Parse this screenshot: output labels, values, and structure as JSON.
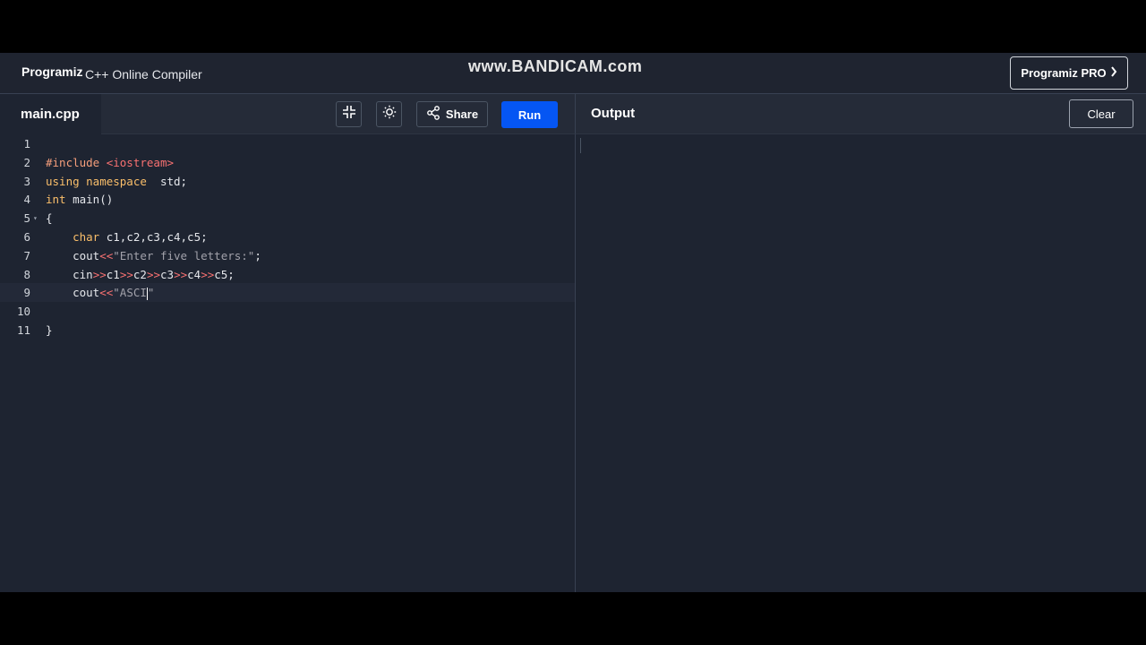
{
  "header": {
    "logo_text": "Programiz",
    "app_title": "C++ Online Compiler",
    "watermark": "www.BANDICAM.com",
    "pro_button": "Programiz PRO"
  },
  "editor_toolbar": {
    "file_name": "main.cpp",
    "share_label": "Share",
    "run_label": "Run"
  },
  "output_panel": {
    "title": "Output",
    "clear_label": "Clear",
    "content": ""
  },
  "code_lines": [
    {
      "n": "1",
      "parts": []
    },
    {
      "n": "2",
      "parts": [
        [
          "kw-pre",
          "#include "
        ],
        [
          "str-inc",
          "<iostream>"
        ]
      ]
    },
    {
      "n": "3",
      "parts": [
        [
          "kw",
          "using namespace"
        ],
        [
          "",
          "  std;"
        ]
      ]
    },
    {
      "n": "4",
      "parts": [
        [
          "ty",
          "int"
        ],
        [
          "",
          " main()"
        ]
      ]
    },
    {
      "n": "5",
      "parts": [
        [
          "",
          "{"
        ]
      ]
    },
    {
      "n": "6",
      "parts": [
        [
          "",
          "    "
        ],
        [
          "ty",
          "char"
        ],
        [
          "",
          " c1,c2,c3,c4,c5;"
        ]
      ]
    },
    {
      "n": "7",
      "parts": [
        [
          "",
          "    cout"
        ],
        [
          "op",
          "<<"
        ],
        [
          "str",
          "\"Enter five letters:\""
        ],
        [
          "",
          ";"
        ]
      ]
    },
    {
      "n": "8",
      "parts": [
        [
          "",
          "    cin"
        ],
        [
          "op",
          ">>"
        ],
        [
          "",
          "c1"
        ],
        [
          "op",
          ">>"
        ],
        [
          "",
          "c2"
        ],
        [
          "op",
          ">>"
        ],
        [
          "",
          "c3"
        ],
        [
          "op",
          ">>"
        ],
        [
          "",
          "c4"
        ],
        [
          "op",
          ">>"
        ],
        [
          "",
          "c5;"
        ]
      ]
    },
    {
      "n": "9",
      "parts": [
        [
          "",
          "    cout"
        ],
        [
          "op",
          "<<"
        ],
        [
          "str",
          "\"ASCI"
        ],
        [
          "cursor",
          ""
        ],
        [
          "str",
          "\""
        ]
      ]
    },
    {
      "n": "10",
      "parts": []
    },
    {
      "n": "11",
      "parts": [
        [
          "",
          "}"
        ]
      ]
    }
  ],
  "colors": {
    "run_button": "#0556f3",
    "background": "#1e2431"
  }
}
